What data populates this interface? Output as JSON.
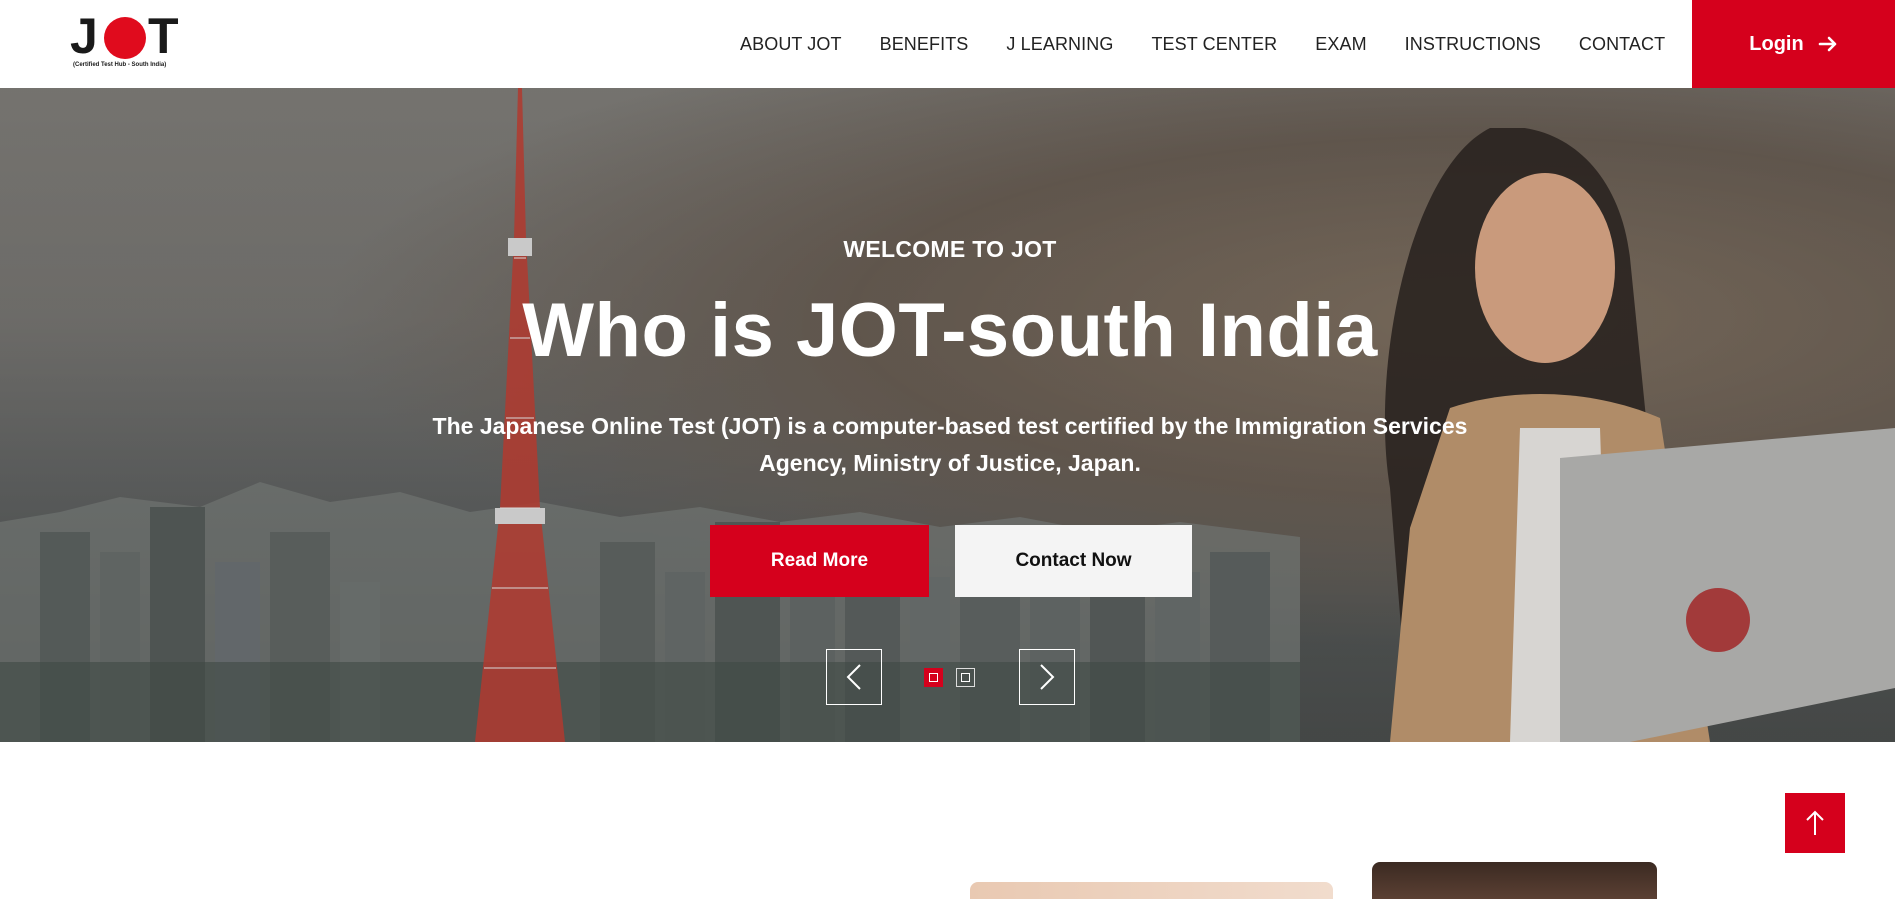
{
  "brand": {
    "logo_text": "JOT",
    "tagline": "(Certified Test Hub - South India)",
    "accent_color": "#d5001c"
  },
  "nav": {
    "items": [
      {
        "label": "ABOUT JOT"
      },
      {
        "label": "BENEFITS"
      },
      {
        "label": "J LEARNING"
      },
      {
        "label": "TEST CENTER"
      },
      {
        "label": "EXAM"
      },
      {
        "label": "INSTRUCTIONS"
      },
      {
        "label": "CONTACT"
      }
    ],
    "login_label": "Login",
    "login_icon": "arrow-right-icon"
  },
  "hero": {
    "eyebrow": "WELCOME TO JOT",
    "title": "Who is JOT-south India",
    "description": "The Japanese Online Test (JOT) is a computer-based test certified by the Immigration Services Agency, Ministry of Justice, Japan.",
    "primary_button": "Read More",
    "secondary_button": "Contact Now",
    "slider": {
      "prev_icon": "chevron-left-icon",
      "next_icon": "chevron-right-icon",
      "slide_count": 2,
      "active_slide": 1
    }
  },
  "scroll_top_icon": "arrow-up-icon"
}
